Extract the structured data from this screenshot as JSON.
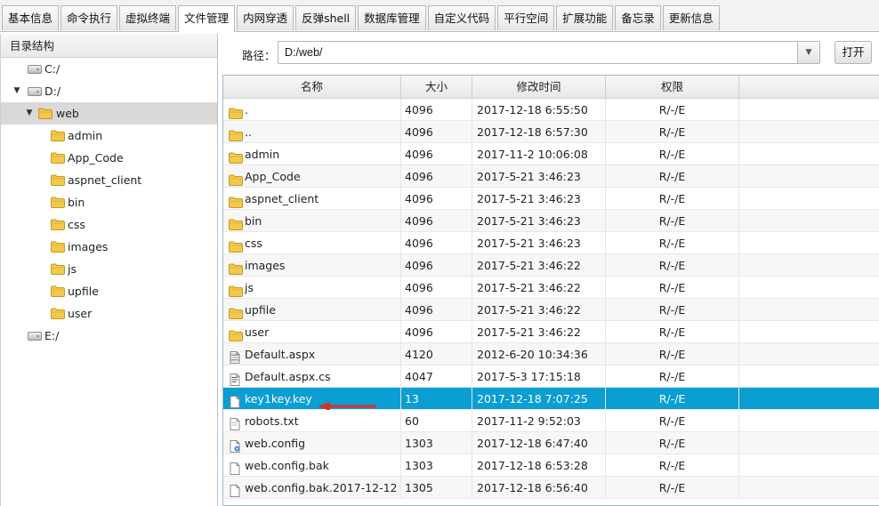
{
  "tabs": [
    {
      "label": "基本信息"
    },
    {
      "label": "命令执行"
    },
    {
      "label": "虚拟终端"
    },
    {
      "label": "文件管理",
      "active": true
    },
    {
      "label": "内网穿透"
    },
    {
      "label": "反弹shell"
    },
    {
      "label": "数据库管理"
    },
    {
      "label": "自定义代码"
    },
    {
      "label": "平行空间"
    },
    {
      "label": "扩展功能"
    },
    {
      "label": "备忘录"
    },
    {
      "label": "更新信息"
    }
  ],
  "tree": {
    "header": "目录结构",
    "nodes": [
      {
        "label": "C:/",
        "type": "drive",
        "level": 0,
        "expanded": false
      },
      {
        "label": "D:/",
        "type": "drive",
        "level": 0,
        "expanded": true
      },
      {
        "label": "web",
        "type": "folder",
        "level": 1,
        "expanded": true,
        "selected": true
      },
      {
        "label": "admin",
        "type": "folder",
        "level": 2
      },
      {
        "label": "App_Code",
        "type": "folder",
        "level": 2
      },
      {
        "label": "aspnet_client",
        "type": "folder",
        "level": 2
      },
      {
        "label": "bin",
        "type": "folder",
        "level": 2
      },
      {
        "label": "css",
        "type": "folder",
        "level": 2
      },
      {
        "label": "images",
        "type": "folder",
        "level": 2
      },
      {
        "label": "js",
        "type": "folder",
        "level": 2
      },
      {
        "label": "upfile",
        "type": "folder",
        "level": 2
      },
      {
        "label": "user",
        "type": "folder",
        "level": 2
      },
      {
        "label": "E:/",
        "type": "drive",
        "level": 0,
        "expanded": false
      }
    ]
  },
  "pathbar": {
    "label": "路径：",
    "value": "D:/web/",
    "open_label": "打开"
  },
  "table": {
    "headers": {
      "name": "名称",
      "size": "大小",
      "mtime": "修改时间",
      "perm": "权限"
    },
    "rows": [
      {
        "name": ".",
        "size": "4096",
        "mtime": "2017-12-18 6:55:50",
        "perm": "R/-/E",
        "icon": "folder"
      },
      {
        "name": "..",
        "size": "4096",
        "mtime": "2017-12-18 6:57:30",
        "perm": "R/-/E",
        "icon": "folder"
      },
      {
        "name": "admin",
        "size": "4096",
        "mtime": "2017-11-2 10:06:08",
        "perm": "R/-/E",
        "icon": "folder"
      },
      {
        "name": "App_Code",
        "size": "4096",
        "mtime": "2017-5-21 3:46:23",
        "perm": "R/-/E",
        "icon": "folder"
      },
      {
        "name": "aspnet_client",
        "size": "4096",
        "mtime": "2017-5-21 3:46:23",
        "perm": "R/-/E",
        "icon": "folder"
      },
      {
        "name": "bin",
        "size": "4096",
        "mtime": "2017-5-21 3:46:23",
        "perm": "R/-/E",
        "icon": "folder"
      },
      {
        "name": "css",
        "size": "4096",
        "mtime": "2017-5-21 3:46:23",
        "perm": "R/-/E",
        "icon": "folder"
      },
      {
        "name": "images",
        "size": "4096",
        "mtime": "2017-5-21 3:46:22",
        "perm": "R/-/E",
        "icon": "folder"
      },
      {
        "name": "js",
        "size": "4096",
        "mtime": "2017-5-21 3:46:22",
        "perm": "R/-/E",
        "icon": "folder"
      },
      {
        "name": "upfile",
        "size": "4096",
        "mtime": "2017-5-21 3:46:22",
        "perm": "R/-/E",
        "icon": "folder"
      },
      {
        "name": "user",
        "size": "4096",
        "mtime": "2017-5-21 3:46:22",
        "perm": "R/-/E",
        "icon": "folder"
      },
      {
        "name": "Default.aspx",
        "size": "4120",
        "mtime": "2012-6-20 10:34:36",
        "perm": "R/-/E",
        "icon": "aspx"
      },
      {
        "name": "Default.aspx.cs",
        "size": "4047",
        "mtime": "2017-5-3 17:15:18",
        "perm": "R/-/E",
        "icon": "code"
      },
      {
        "name": "key1key.key",
        "size": "13",
        "mtime": "2017-12-18 7:07:25",
        "perm": "R/-/E",
        "icon": "file",
        "selected": true
      },
      {
        "name": "robots.txt",
        "size": "60",
        "mtime": "2017-11-2 9:52:03",
        "perm": "R/-/E",
        "icon": "text"
      },
      {
        "name": "web.config",
        "size": "1303",
        "mtime": "2017-12-18 6:47:40",
        "perm": "R/-/E",
        "icon": "config"
      },
      {
        "name": "web.config.bak",
        "size": "1303",
        "mtime": "2017-12-18 6:53:28",
        "perm": "R/-/E",
        "icon": "file"
      },
      {
        "name": "web.config.bak.2017-12-12",
        "size": "1305",
        "mtime": "2017-12-18 6:56:40",
        "perm": "R/-/E",
        "icon": "file"
      }
    ]
  },
  "colors": {
    "selected_row": "#0a9ed3",
    "folder": "#f2c94c",
    "annotation_arrow": "#d9302a"
  }
}
